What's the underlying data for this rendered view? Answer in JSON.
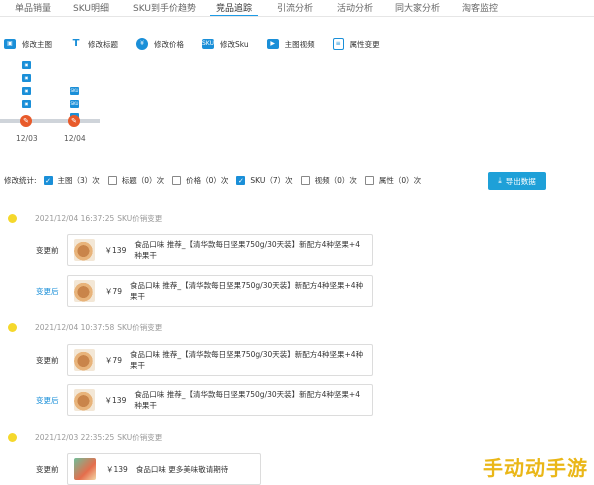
{
  "tabs": [
    {
      "label": "单品销量",
      "active": false
    },
    {
      "label": "SKU明细",
      "active": false
    },
    {
      "label": "SKU到手价趋势",
      "active": false
    },
    {
      "label": "竞品追踪",
      "active": true
    },
    {
      "label": "引流分析",
      "active": false
    },
    {
      "label": "活动分析",
      "active": false
    },
    {
      "label": "同大家分析",
      "active": false
    },
    {
      "label": "淘客监控",
      "active": false
    }
  ],
  "toolbar": [
    {
      "icon": "main-image-icon",
      "label": "修改主图"
    },
    {
      "icon": "title-icon",
      "label": "修改标题"
    },
    {
      "icon": "price-icon",
      "label": "修改价格"
    },
    {
      "icon": "sku-icon",
      "label": "修改Sku"
    },
    {
      "icon": "video-icon",
      "label": "主图视频"
    },
    {
      "icon": "property-icon",
      "label": "属性变更"
    }
  ],
  "timeline": {
    "points": [
      {
        "date": "12/03",
        "icons": [
          "main-image-icon",
          "main-image-icon",
          "main-image-icon",
          "main-image-icon"
        ]
      },
      {
        "date": "12/04",
        "icons": [
          "sku-icon",
          "sku-icon",
          "main-image-icon"
        ]
      }
    ]
  },
  "stats": {
    "prefix": "修改统计:",
    "items": [
      {
        "label": "主图（3）次",
        "checked": true
      },
      {
        "label": "标题（0）次",
        "checked": false
      },
      {
        "label": "价格（0）次",
        "checked": false
      },
      {
        "label": "SKU（7）次",
        "checked": true
      },
      {
        "label": "视频（0）次",
        "checked": false
      },
      {
        "label": "属性（0）次",
        "checked": false
      }
    ],
    "export_label": "导出数据"
  },
  "events": [
    {
      "time": "2021/12/04 16:37:25",
      "type": "SKU价销变更",
      "before": {
        "label": "变更前",
        "price": "￥139",
        "text": "食品口味 推荐_【清华款每日坚果750g/30天装】新配方4种坚果+4种果干"
      },
      "after": {
        "label": "变更后",
        "price": "￥79",
        "text": "食品口味 推荐_【清华款每日坚果750g/30天装】新配方4种坚果+4种果干"
      }
    },
    {
      "time": "2021/12/04 10:37:58",
      "type": "SKU价销变更",
      "before": {
        "label": "变更前",
        "price": "￥79",
        "text": "食品口味 推荐_【清华款每日坚果750g/30天装】新配方4种坚果+4种果干"
      },
      "after": {
        "label": "变更后",
        "price": "￥139",
        "text": "食品口味 推荐_【清华款每日坚果750g/30天装】新配方4种坚果+4种果干"
      }
    },
    {
      "time": "2021/12/03 22:35:25",
      "type": "SKU价销变更",
      "before": {
        "label": "变更前",
        "price": "￥139",
        "text": "食品口味 更多美味敬请期待"
      }
    }
  ],
  "watermark": "手动动手游"
}
